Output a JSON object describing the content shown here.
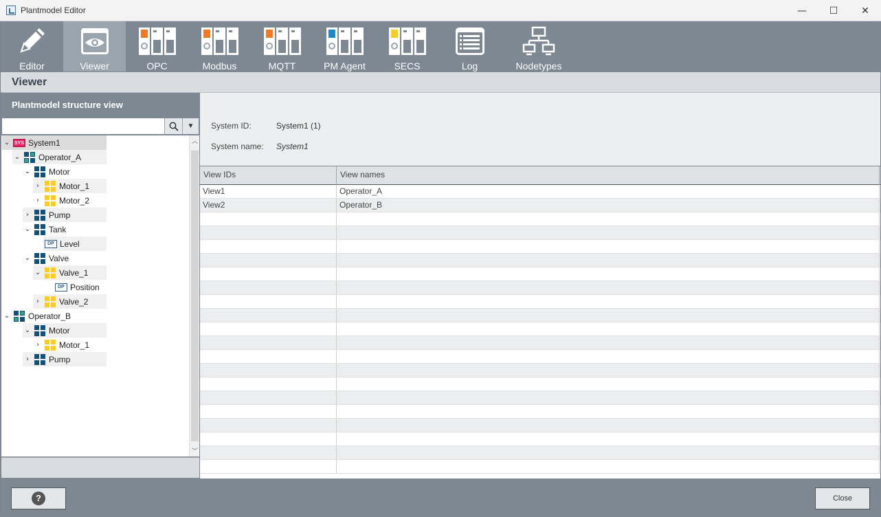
{
  "window": {
    "title": "Plantmodel Editor",
    "minimize": "—",
    "maximize": "☐",
    "close": "✕"
  },
  "toolbar": [
    {
      "label": "Editor",
      "icon": "pencil-icon"
    },
    {
      "label": "Viewer",
      "icon": "eye-icon",
      "active": true
    },
    {
      "label": "OPC",
      "icon": "opc-module-icon"
    },
    {
      "label": "Modbus",
      "icon": "modbus-module-icon"
    },
    {
      "label": "MQTT",
      "icon": "mqtt-module-icon"
    },
    {
      "label": "PM Agent",
      "icon": "pm-agent-module-icon"
    },
    {
      "label": "SECS",
      "icon": "secs-module-icon"
    },
    {
      "label": "Log",
      "icon": "log-list-icon"
    },
    {
      "label": "Nodetypes",
      "icon": "network-tree-icon"
    }
  ],
  "section_title": "Viewer",
  "left": {
    "header": "Plantmodel structure view",
    "search_placeholder": "",
    "tree": [
      {
        "label": "System1",
        "icon": "sys",
        "badge": "SYS",
        "chevron": "expanded"
      },
      {
        "label": "Operator_A",
        "icon": "op",
        "chevron": "expanded"
      },
      {
        "label": "Motor",
        "icon": "blue",
        "chevron": "expanded"
      },
      {
        "label": "Motor_1",
        "icon": "yellow",
        "chevron": "collapsed"
      },
      {
        "label": "Motor_2",
        "icon": "yellow",
        "chevron": "collapsed"
      },
      {
        "label": "Pump",
        "icon": "blue",
        "chevron": "collapsed"
      },
      {
        "label": "Tank",
        "icon": "blue",
        "chevron": "expanded"
      },
      {
        "label": "Level",
        "icon": "dp",
        "badge": "DP",
        "chevron": "none"
      },
      {
        "label": "Valve",
        "icon": "blue",
        "chevron": "expanded"
      },
      {
        "label": "Valve_1",
        "icon": "yellow",
        "chevron": "expanded"
      },
      {
        "label": "Position",
        "icon": "dp",
        "badge": "DP",
        "chevron": "none"
      },
      {
        "label": "Valve_2",
        "icon": "yellow",
        "chevron": "collapsed"
      },
      {
        "label": "Operator_B",
        "icon": "op",
        "chevron": "expanded"
      },
      {
        "label": "Motor",
        "icon": "blue",
        "chevron": "expanded"
      },
      {
        "label": "Motor_1",
        "icon": "yellow",
        "chevron": "collapsed"
      },
      {
        "label": "Pump",
        "icon": "blue",
        "chevron": "collapsed"
      }
    ]
  },
  "info": {
    "system_id_label": "System ID:",
    "system_id_value": "System1 (1)",
    "system_name_label": "System name:",
    "system_name_value": "System1"
  },
  "table": {
    "headers": [
      "View IDs",
      "View names"
    ],
    "rows": [
      [
        "View1",
        "Operator_A"
      ],
      [
        "View2",
        "Operator_B"
      ]
    ]
  },
  "buttons": {
    "help": "?",
    "close": "Close"
  },
  "colors": {
    "toolbar": "#7d8893",
    "active_tab": "#9aa4ad",
    "node_blue": "#13517a",
    "node_yellow": "#ffcc1a",
    "sys_badge": "#e91e63",
    "opc": "#f47920",
    "pm_agent": "#1e88c8",
    "secs": "#ffcc1a"
  }
}
